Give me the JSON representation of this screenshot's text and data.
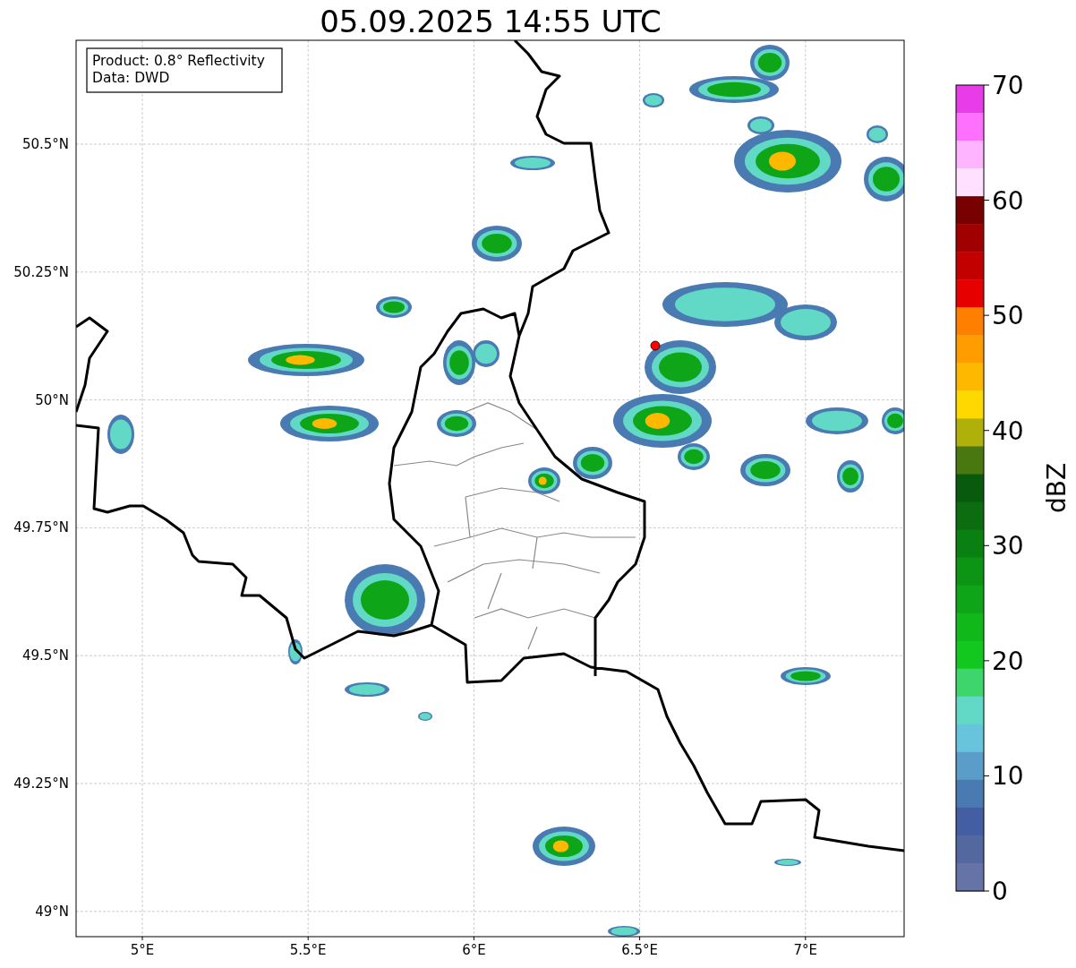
{
  "title": "05.09.2025 14:55 UTC",
  "info_box": [
    "Product: 0.8° Reflectivity",
    "Data: DWD"
  ],
  "map": {
    "lat_ticks": [
      "50.5°N",
      "50.25°N",
      "50°N",
      "49.75°N",
      "49.5°N",
      "49.25°N",
      "49°N"
    ],
    "lon_ticks": [
      "5°E",
      "5.5°E",
      "6°E",
      "6.5°E",
      "7°E"
    ]
  },
  "colorbar": {
    "label": "dBZ",
    "ticks": [
      "70",
      "60",
      "50",
      "40",
      "30",
      "20",
      "10",
      "0"
    ],
    "bands": [
      {
        "color": "#e83ce8"
      },
      {
        "color": "#ff70ff"
      },
      {
        "color": "#ffb4ff"
      },
      {
        "color": "#ffe0ff"
      },
      {
        "color": "#780000"
      },
      {
        "color": "#a00000"
      },
      {
        "color": "#c20000"
      },
      {
        "color": "#e60000"
      },
      {
        "color": "#ff8000"
      },
      {
        "color": "#ff9c00"
      },
      {
        "color": "#ffb800"
      },
      {
        "color": "#ffd800"
      },
      {
        "color": "#b0b00a"
      },
      {
        "color": "#4a7810"
      },
      {
        "color": "#085a0c"
      },
      {
        "color": "#0b6c10"
      },
      {
        "color": "#0a8012"
      },
      {
        "color": "#0c9414"
      },
      {
        "color": "#0ea618"
      },
      {
        "color": "#10b81a"
      },
      {
        "color": "#12c81e"
      },
      {
        "color": "#3cd66c"
      },
      {
        "color": "#62d9c6"
      },
      {
        "color": "#68c3dc"
      },
      {
        "color": "#5a9dc8"
      },
      {
        "color": "#4a7ab2"
      },
      {
        "color": "#445ea3"
      },
      {
        "color": "#53689f"
      },
      {
        "color": "#6673a6"
      }
    ]
  }
}
